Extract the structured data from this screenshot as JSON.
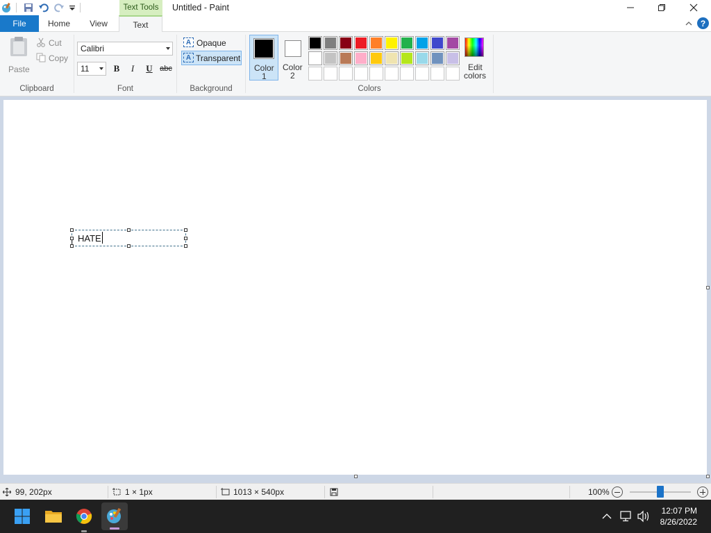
{
  "window": {
    "title": "Untitled - Paint",
    "context_tab": "Text Tools"
  },
  "tabs": {
    "file": "File",
    "home": "Home",
    "view": "View",
    "text": "Text"
  },
  "clipboard": {
    "paste": "Paste",
    "cut": "Cut",
    "copy": "Copy",
    "group_label": "Clipboard"
  },
  "font": {
    "family": "Calibri",
    "size": "11",
    "bold": "B",
    "italic": "I",
    "underline": "U",
    "strike": "abc",
    "group_label": "Font"
  },
  "background": {
    "opaque": "Opaque",
    "transparent": "Transparent",
    "group_label": "Background"
  },
  "colors": {
    "color1_line1": "Color",
    "color1_line2": "1",
    "color2_line1": "Color",
    "color2_line2": "2",
    "edit_line1": "Edit",
    "edit_line2": "colors",
    "group_label": "Colors",
    "color1_value": "#000000",
    "color2_value": "#ffffff",
    "palette_row1": [
      "#000000",
      "#7f7f7f",
      "#880015",
      "#ed1c24",
      "#ff7f27",
      "#fff200",
      "#22b14c",
      "#00a2e8",
      "#3f48cc",
      "#a349a4"
    ],
    "palette_row2": [
      "#ffffff",
      "#c3c3c3",
      "#b97a57",
      "#ffaec9",
      "#ffc90e",
      "#efe4b0",
      "#b5e61d",
      "#99d9ea",
      "#7092be",
      "#c8bfe7"
    ],
    "palette_row3": [
      "#ffffff",
      "#ffffff",
      "#ffffff",
      "#ffffff",
      "#ffffff",
      "#ffffff",
      "#ffffff",
      "#ffffff",
      "#ffffff",
      "#ffffff"
    ]
  },
  "canvas": {
    "text": "HATE"
  },
  "status": {
    "cursor_pos": "99, 202px",
    "selection_size": "1 × 1px",
    "image_size": "1013 × 540px",
    "zoom": "100%"
  },
  "taskbar": {
    "time": "12:07 PM",
    "date": "8/26/2022"
  }
}
